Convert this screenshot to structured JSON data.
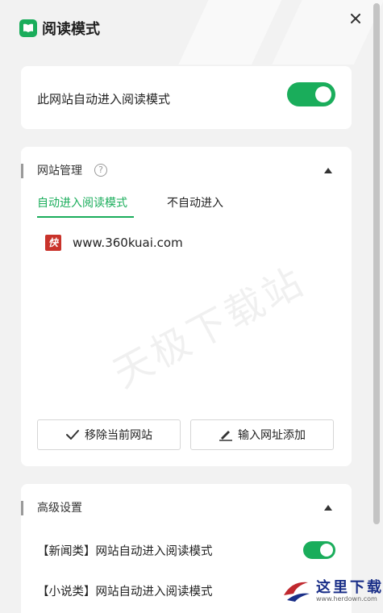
{
  "header": {
    "title": "阅读模式",
    "logo_icon": "book-icon",
    "close_icon": "close-icon"
  },
  "auto_mode": {
    "label": "此网站自动进入阅读模式",
    "enabled": true
  },
  "site_management": {
    "title": "网站管理",
    "help_glyph": "?",
    "tabs": [
      {
        "label": "自动进入阅读模式",
        "active": true
      },
      {
        "label": "不自动进入",
        "active": false
      }
    ],
    "sites": [
      {
        "favicon_text": "快",
        "url": "www.360kuai.com"
      }
    ],
    "watermark": "天极下载站",
    "remove_button": "移除当前网站",
    "add_button": "输入网址添加"
  },
  "advanced": {
    "title": "高级设置",
    "items": [
      {
        "label": "【新闻类】网站自动进入阅读模式",
        "enabled": true
      },
      {
        "label": "【小说类】网站自动进入阅读模式",
        "enabled": false
      }
    ]
  },
  "brand": {
    "text": "这里下载",
    "url": "www.herdown.com"
  },
  "colors": {
    "accent": "#1aad5b",
    "background": "#f2f2f2"
  }
}
